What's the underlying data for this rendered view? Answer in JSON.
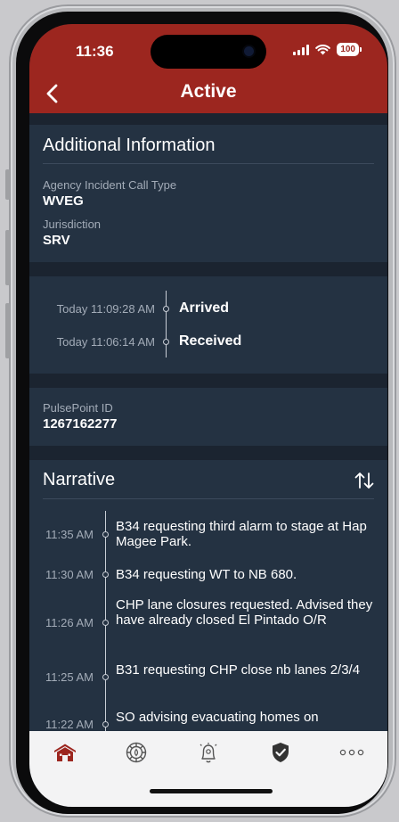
{
  "status_bar": {
    "time": "11:36",
    "battery": "100"
  },
  "header": {
    "title": "Active"
  },
  "additional_info": {
    "title": "Additional Information",
    "fields": [
      {
        "label": "Agency Incident Call Type",
        "value": "WVEG"
      },
      {
        "label": "Jurisdiction",
        "value": "SRV"
      }
    ]
  },
  "timeline": [
    {
      "time": "Today 11:09:28 AM",
      "status": "Arrived"
    },
    {
      "time": "Today 11:06:14 AM",
      "status": "Received"
    }
  ],
  "pulsepoint": {
    "label": "PulsePoint ID",
    "value": "1267162277"
  },
  "narrative": {
    "title": "Narrative",
    "entries": [
      {
        "time": "11:35 AM",
        "text": "B34 requesting third alarm to stage at Hap Magee Park."
      },
      {
        "time": "11:30 AM",
        "text": "B34 requesting WT to NB 680."
      },
      {
        "time": "11:26 AM",
        "text": "CHP lane closures requested. Advised they have already closed El Pintado O/R"
      },
      {
        "time": "11:25 AM",
        "text": "B31 requesting CHP close nb lanes 2/3/4"
      },
      {
        "time": "11:22 AM",
        "text": "SO advising evacuating homes on"
      }
    ]
  },
  "tabbar": {
    "tabs": [
      {
        "icon": "station-icon",
        "active": true
      },
      {
        "icon": "fire-badge-icon",
        "active": false
      },
      {
        "icon": "alert-bell-icon",
        "active": false
      },
      {
        "icon": "shield-check-icon",
        "active": false
      },
      {
        "icon": "more-icon",
        "active": false
      }
    ]
  },
  "colors": {
    "accent": "#9c261f",
    "background": "#1b2430",
    "card": "#243242",
    "tabbar": "#f3f3f4"
  }
}
